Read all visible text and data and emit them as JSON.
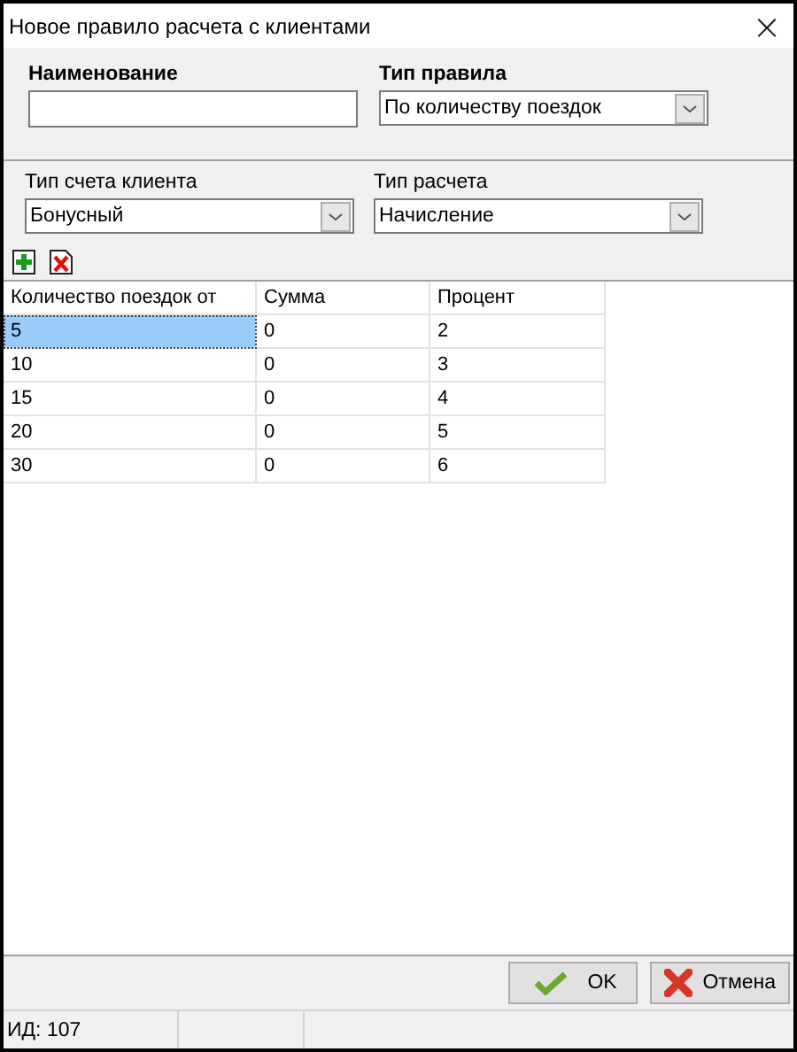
{
  "window": {
    "title": "Новое правило расчета с клиентами",
    "close": "×"
  },
  "fields_top": [
    {
      "label": "Наименование",
      "kind": "text"
    },
    {
      "label": "Тип правила",
      "kind": "select",
      "value": "По количеству поездок"
    }
  ],
  "fields_bottom": [
    {
      "label": "Тип счета клиента",
      "kind": "select",
      "value": "Бонусный"
    },
    {
      "label": "Тип расчета",
      "kind": "select",
      "value": "Начисление"
    }
  ],
  "table": {
    "columns": [
      "Количество поездок от",
      "Сумма",
      "Процент"
    ],
    "rows": [
      {
        "cells": [
          "5",
          "0",
          "2"
        ],
        "selected": true
      },
      {
        "cells": [
          "10",
          "0",
          "3"
        ],
        "selected": false
      },
      {
        "cells": [
          "15",
          "0",
          "4"
        ],
        "selected": false
      },
      {
        "cells": [
          "20",
          "0",
          "5"
        ],
        "selected": false
      },
      {
        "cells": [
          "30",
          "0",
          "6"
        ],
        "selected": false
      }
    ]
  },
  "buttons": [
    {
      "label": "OK",
      "kind": "ok"
    },
    {
      "label": "Отмена",
      "kind": "cancel"
    }
  ],
  "status_bar": [
    "ИД: 107"
  ]
}
